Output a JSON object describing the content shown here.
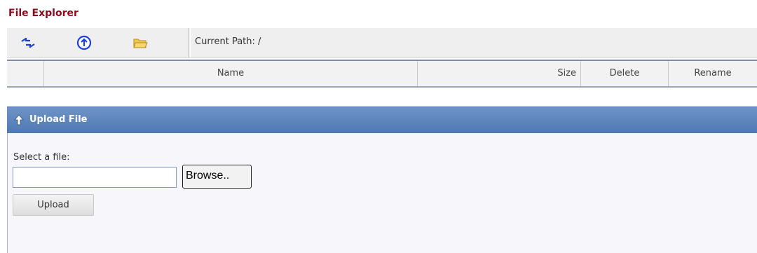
{
  "title": "File Explorer",
  "toolbar": {
    "buttons": [
      {
        "name": "refresh",
        "icon": "refresh-arrows-icon"
      },
      {
        "name": "up-folder",
        "icon": "up-circle-icon"
      },
      {
        "name": "new-folder",
        "icon": "folder-icon"
      }
    ],
    "current_path_label": "Current Path: /"
  },
  "grid": {
    "columns": [
      "",
      "Name",
      "Size",
      "Delete",
      "Rename"
    ]
  },
  "upload": {
    "header": "Upload File",
    "icon": "up-arrow-icon",
    "select_label": "Select a file:",
    "file_value": "",
    "browse_label": "Browse..",
    "upload_label": "Upload"
  },
  "colors": {
    "title": "#8b0a1e",
    "panel_header": "#5a81b9",
    "accent_blue": "#1f3fd6"
  }
}
